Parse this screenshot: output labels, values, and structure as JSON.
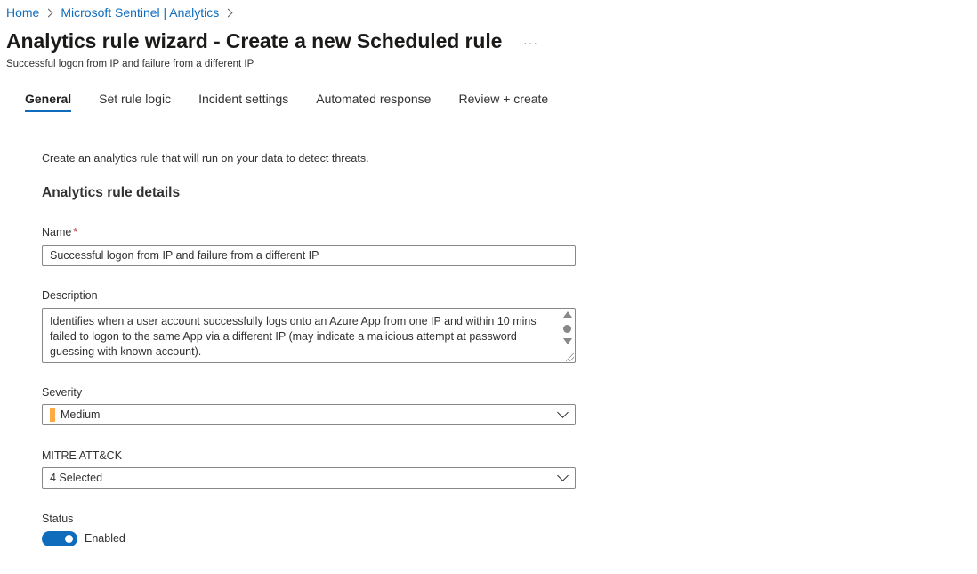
{
  "breadcrumb": {
    "items": [
      "Home",
      "Microsoft Sentinel | Analytics"
    ]
  },
  "header": {
    "title": "Analytics rule wizard - Create a new Scheduled rule",
    "more_icon": "ellipsis-icon",
    "more_glyph": "···",
    "subtitle": "Successful logon from IP and failure from a different IP"
  },
  "tabs": [
    {
      "label": "General",
      "active": true
    },
    {
      "label": "Set rule logic",
      "active": false
    },
    {
      "label": "Incident settings",
      "active": false
    },
    {
      "label": "Automated response",
      "active": false
    },
    {
      "label": "Review + create",
      "active": false
    }
  ],
  "general": {
    "intro": "Create an analytics rule that will run on your data to detect threats.",
    "section_title": "Analytics rule details",
    "name": {
      "label": "Name",
      "required_marker": "*",
      "value": "Successful logon from IP and failure from a different IP"
    },
    "description": {
      "label": "Description",
      "value": "Identifies when a user account successfully logs onto an Azure App from one IP and within 10 mins failed to logon to the same App via a different IP (may indicate a malicious attempt at password guessing with known account)."
    },
    "severity": {
      "label": "Severity",
      "value": "Medium",
      "color": "#ffaa44"
    },
    "mitre": {
      "label": "MITRE ATT&CK",
      "value": "4 Selected"
    },
    "status": {
      "label": "Status",
      "value": "Enabled",
      "enabled": true
    }
  },
  "colors": {
    "accent": "#0f6cbd",
    "required": "#a4262c",
    "severity_medium": "#ffaa44"
  }
}
